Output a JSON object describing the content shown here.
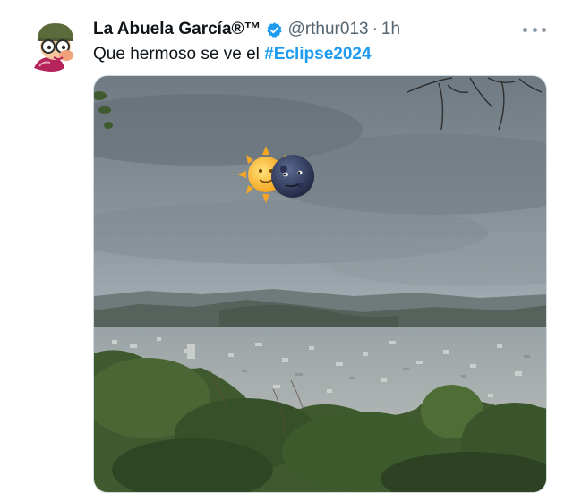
{
  "tweet": {
    "display_name": "La Abuela García®™",
    "handle": "@rthur013",
    "separator": "·",
    "time": "1h",
    "text_prefix": "Que hermoso se ve el ",
    "hashtag": "#Eclipse2024",
    "media_emojis": [
      "sun-emoji",
      "new-moon-face-emoji"
    ]
  },
  "icons": {
    "verified": "verified-badge-icon",
    "more": "more-options-icon"
  },
  "colors": {
    "hashtag": "#1d9bf0",
    "verified": "#1d9bf0",
    "secondary_text": "#536471"
  }
}
